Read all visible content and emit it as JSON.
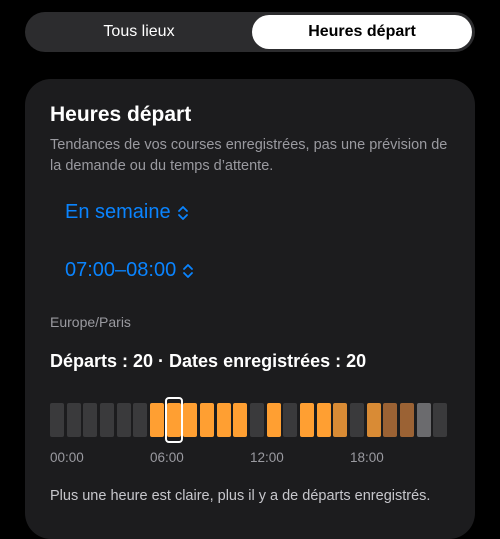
{
  "tabs": [
    {
      "label": "Tous lieux",
      "selected": false
    },
    {
      "label": "Heures départ",
      "selected": true
    }
  ],
  "card": {
    "title": "Heures départ",
    "subtitle": "Tendances de vos courses enregistrées, pas une prévision de la demande ou du temps d’attente.",
    "day_picker": "En semaine",
    "time_picker": "07:00–08:00",
    "timezone": "Europe/Paris",
    "stats": "Départs : 20 · Dates enregistrées : 20",
    "ticks": [
      "00:00",
      "06:00",
      "12:00",
      "18:00"
    ],
    "legend": "Plus une heure est claire, plus il y a de départs enregistrés."
  },
  "chart_data": {
    "type": "heatmap",
    "categories": [
      "0",
      "1",
      "2",
      "3",
      "4",
      "5",
      "6",
      "7",
      "8",
      "9",
      "10",
      "11",
      "12",
      "13",
      "14",
      "15",
      "16",
      "17",
      "18",
      "19",
      "20",
      "21",
      "22",
      "23"
    ],
    "values": [
      0,
      0,
      0,
      0,
      0,
      0,
      3,
      3,
      3,
      3,
      3,
      3,
      0,
      3,
      0,
      3,
      3,
      2,
      0,
      2,
      1,
      1,
      0.5,
      0
    ],
    "selected_index": 7,
    "colors": {
      "empty": "#3a3a3c",
      "high": "#ff9f32",
      "mid": "#d98b35",
      "low": "#9b6234",
      "faint": "#6b6b6e",
      "accent": "#0a84ff"
    }
  }
}
